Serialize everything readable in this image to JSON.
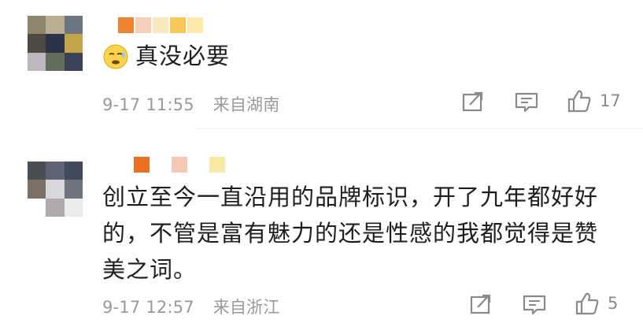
{
  "comments": [
    {
      "text": "真没必要",
      "emoji": "sweat-emoji",
      "time": "9-17 11:55",
      "source": "来自湖南",
      "likes": "17",
      "avatar_colors": [
        "#8e866a",
        "#b9ae92",
        "#6b7682",
        "#4d4a43",
        "#2a3347",
        "#c4a64a",
        "#bdb6bd",
        "#626f5c",
        "#3a4158"
      ],
      "name_colors": [
        "#ee8233",
        "#f5d0b8",
        "#f7e8bd",
        "#f6c859",
        "#fae9a8"
      ]
    },
    {
      "text_lines": [
        "创立至今一直沿用的品牌标识，开了九年都好好",
        "的，不管是富有魅力的还是性感的我都觉得是赞",
        "美之词。"
      ],
      "time": "9-17 12:57",
      "source": "来自浙江",
      "likes": "5",
      "avatar_colors": [
        "#4b4d55",
        "#5e6472",
        "#3f4a5d",
        "#7b6f66",
        "#d7d6db",
        "#6e747e",
        "#ffffff",
        "#b1a9ad",
        "#e9ecea"
      ],
      "name_colors": [
        "#e9701e",
        "#f5c9b3",
        "#f6e9a3"
      ]
    }
  ],
  "icons": {
    "repost": "repost-icon",
    "comment": "comment-icon",
    "like": "like-icon"
  }
}
